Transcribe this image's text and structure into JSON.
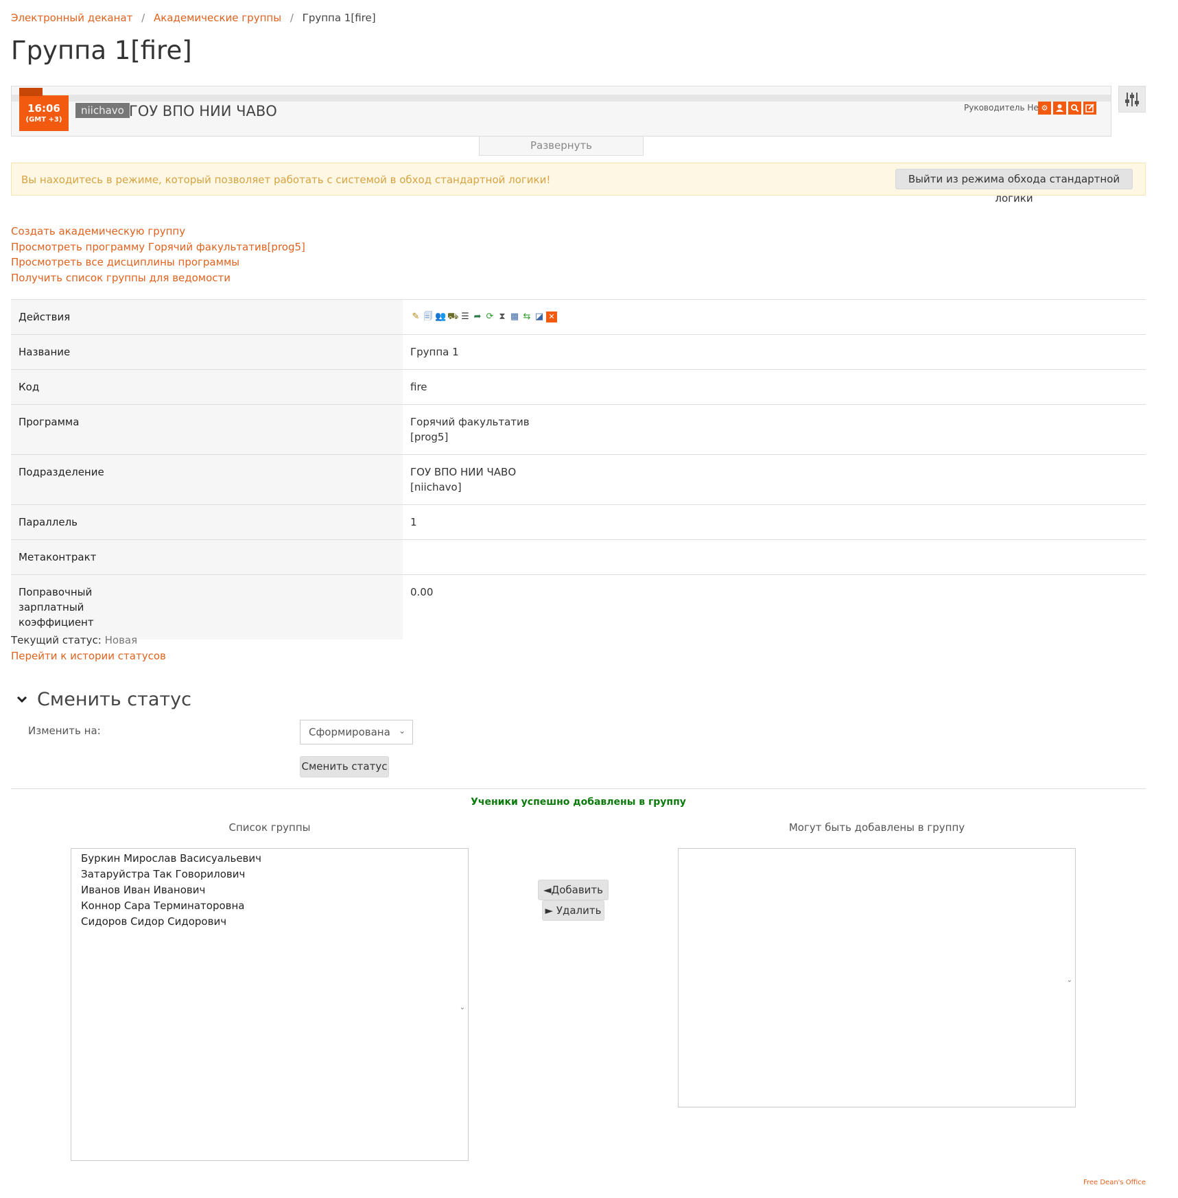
{
  "breadcrumb": {
    "items": [
      "Электронный деканат",
      "Академические группы"
    ],
    "current": "Группа 1[fire]",
    "separator": "/"
  },
  "page_title": "Группа 1[fire]",
  "header": {
    "clock_time": "16:06",
    "clock_tz": "(GMT +3)",
    "org_code": "niichavo",
    "org_name": "ГОУ ВПО НИИ ЧАВО",
    "head_label": "Руководитель Нет",
    "expand_label": "Развернуть",
    "icons": [
      "gear-icon",
      "user-icon",
      "search-icon",
      "edit-icon"
    ],
    "accent_color": "#f15a0f"
  },
  "alert": {
    "message": "Вы находитесь в режиме, который позволяет работать с системой в обход стандартной логики!",
    "exit_button": "Выйти из режима обхода стандартной логики"
  },
  "links": [
    "Создать академическую группу",
    "Просмотреть программу Горячий факультатив[prog5]",
    "Просмотреть все дисциплины программы",
    "Получить список группы для ведомости"
  ],
  "info_table": {
    "actions_label": "Действия",
    "action_icons": [
      "edit-icon",
      "view-icon",
      "students-icon",
      "enroll-icon",
      "list-icon",
      "transfer-icon",
      "refresh-icon",
      "history-icon",
      "calendar-icon",
      "sync-icon",
      "report-icon",
      "delete-icon"
    ],
    "rows": [
      {
        "key": "Название",
        "value": "Группа 1"
      },
      {
        "key": "Код",
        "value": "fire"
      },
      {
        "key": "Программа",
        "value": "Горячий факультатив",
        "value2": "[prog5]"
      },
      {
        "key": "Подразделение",
        "value": "ГОУ ВПО НИИ ЧАВО",
        "value2": "[niichavo]"
      },
      {
        "key": "Параллель",
        "value": "1"
      },
      {
        "key": "Метаконтракт",
        "value": ""
      },
      {
        "key": "Поправочный зарплатный коэффициент",
        "value": "0.00"
      }
    ]
  },
  "status": {
    "label": "Текущий статус:",
    "value": "Новая",
    "history_link": "Перейти к истории статусов"
  },
  "change_status": {
    "title": "Сменить статус",
    "field_label": "Изменить на:",
    "selected": "Сформирована",
    "button": "Сменить статус"
  },
  "students": {
    "success_message": "Ученики успешно добавлены в группу",
    "group_list_title": "Список группы",
    "candidates_title": "Могут быть добавлены в группу",
    "group_members": [
      "Буркин Мирослав Васисуальевич",
      "Затаруйстра Так Говорилович",
      "Иванов Иван Иванович",
      "Коннор Сара Терминаторовна",
      "Сидоров Сидор Сидорович"
    ],
    "candidates": [],
    "add_button": "◄Добавить",
    "remove_button": "► Удалить"
  },
  "footer": "Free Dean's Office"
}
